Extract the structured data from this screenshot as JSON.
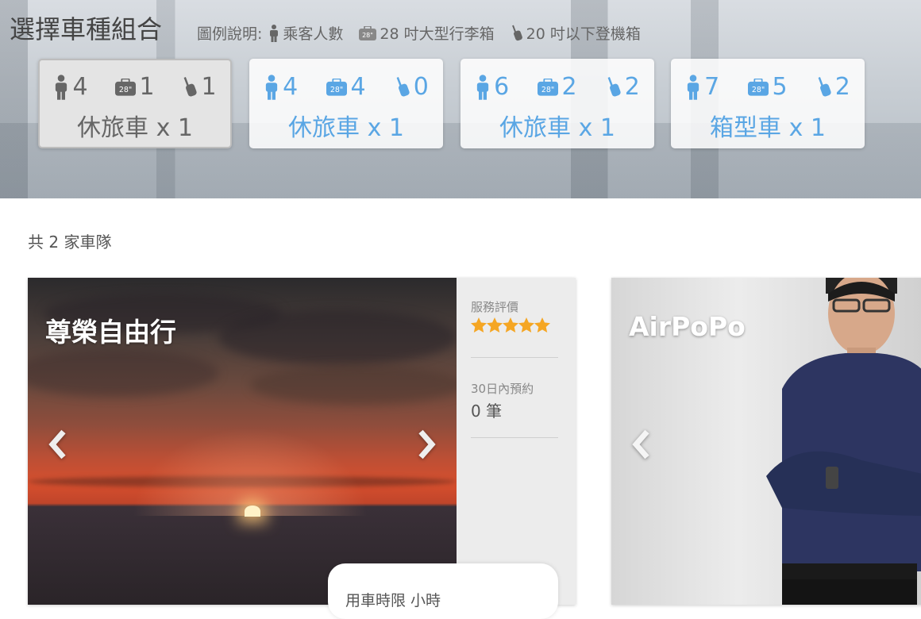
{
  "header": {
    "title": "選擇車種組合",
    "legend_label": "圖例說明:",
    "legend": [
      {
        "icon": "person-icon",
        "text": "乘客人數"
      },
      {
        "icon": "large-suitcase-icon",
        "text": "28 吋大型行李箱"
      },
      {
        "icon": "carry-on-suitcase-icon",
        "text": "20 吋以下登機箱"
      }
    ]
  },
  "vehicle_options": [
    {
      "passengers": "4",
      "large_luggage": "1",
      "small_luggage": "1",
      "vehicle": "休旅車",
      "qty": "x 1",
      "selected": true
    },
    {
      "passengers": "4",
      "large_luggage": "4",
      "small_luggage": "0",
      "vehicle": "休旅車",
      "qty": "x 1",
      "selected": false
    },
    {
      "passengers": "6",
      "large_luggage": "2",
      "small_luggage": "2",
      "vehicle": "休旅車",
      "qty": "x 1",
      "selected": false
    },
    {
      "passengers": "7",
      "large_luggage": "5",
      "small_luggage": "2",
      "vehicle": "箱型車",
      "qty": "x 1",
      "selected": false
    }
  ],
  "results": {
    "count_text": "共 2 家車隊"
  },
  "fleets": [
    {
      "name": "尊榮自由行",
      "rating_label": "服務評價",
      "rating": 5,
      "bookings_label": "30日內預約",
      "bookings_value": "0 筆",
      "popup_text": "用車時限 小時"
    },
    {
      "name": "AirPoPo"
    }
  ],
  "colors": {
    "accent": "#5aa6e4",
    "star": "#f5a623"
  }
}
